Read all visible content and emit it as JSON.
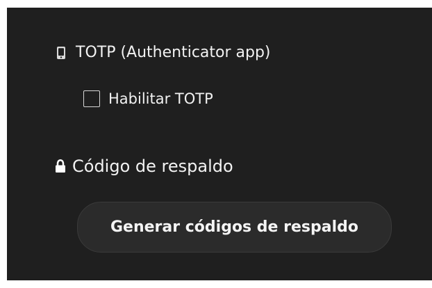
{
  "security_panel": {
    "totp": {
      "heading": "TOTP (Authenticator app)",
      "icon": "mobile-phone-icon",
      "checkbox_label": "Habilitar TOTP",
      "checkbox_checked": false
    },
    "backup": {
      "heading": "Código de respaldo",
      "icon": "lock-icon",
      "button_label": "Generar códigos de respaldo"
    }
  }
}
